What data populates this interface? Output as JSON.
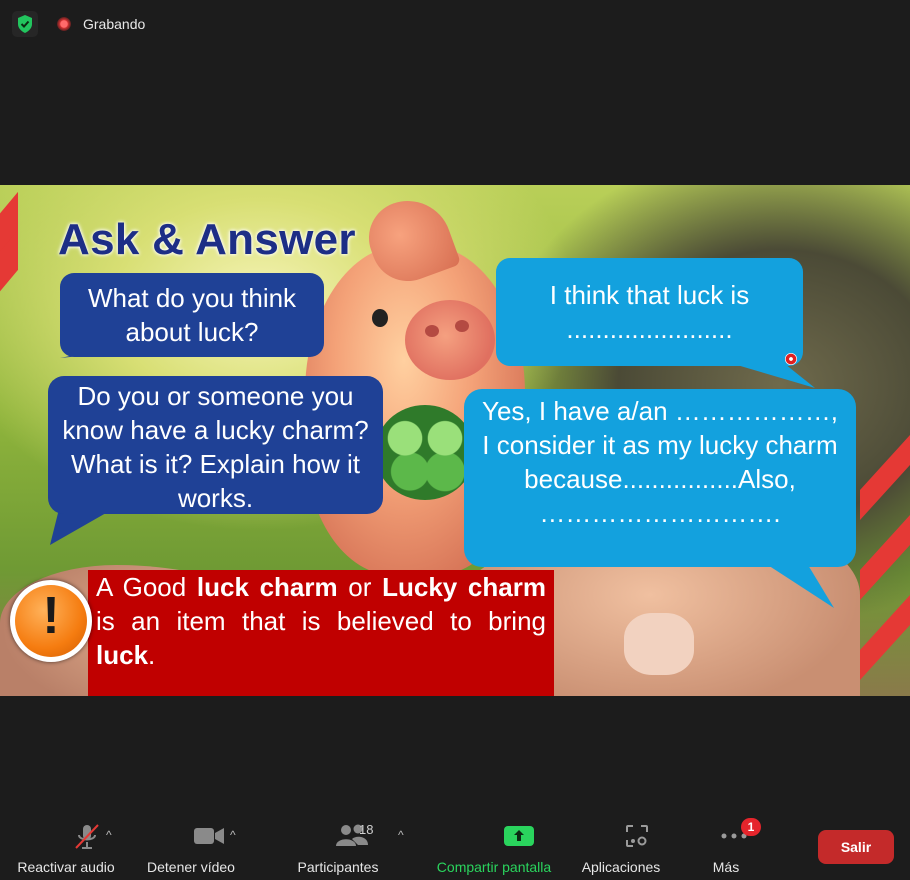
{
  "recording": {
    "label": "Grabando"
  },
  "slide": {
    "title": "Ask & Answer",
    "bubbles": {
      "q1": "What do you think about luck?",
      "q2": "Do you or someone you know have a lucky charm? What is it? Explain how it works.",
      "a1": "I think that luck is .......................",
      "a2": "Yes, I have a/an ………………, I consider it as my lucky charm because................Also, ………………………."
    },
    "definition": {
      "t1": "A Good ",
      "b1": "luck charm",
      "t2": " or ",
      "b2": "Lucky charm",
      "t3": " is an item that is believed to bring ",
      "b3": "luck",
      "t4": "."
    },
    "alert_symbol": "!"
  },
  "toolbar": {
    "audio": "Reactivar audio",
    "video": "Detener vídeo",
    "participants": "Participantes",
    "participants_count": "18",
    "share": "Compartir pantalla",
    "apps": "Aplicaciones",
    "more": "Más",
    "more_badge": "1",
    "leave": "Salir"
  },
  "colors": {
    "share_green": "#2ad45d",
    "leave_red": "#c42a2a",
    "bubble_dark": "#1f4196",
    "bubble_light": "#13a1de",
    "definition_red": "#c00000"
  }
}
